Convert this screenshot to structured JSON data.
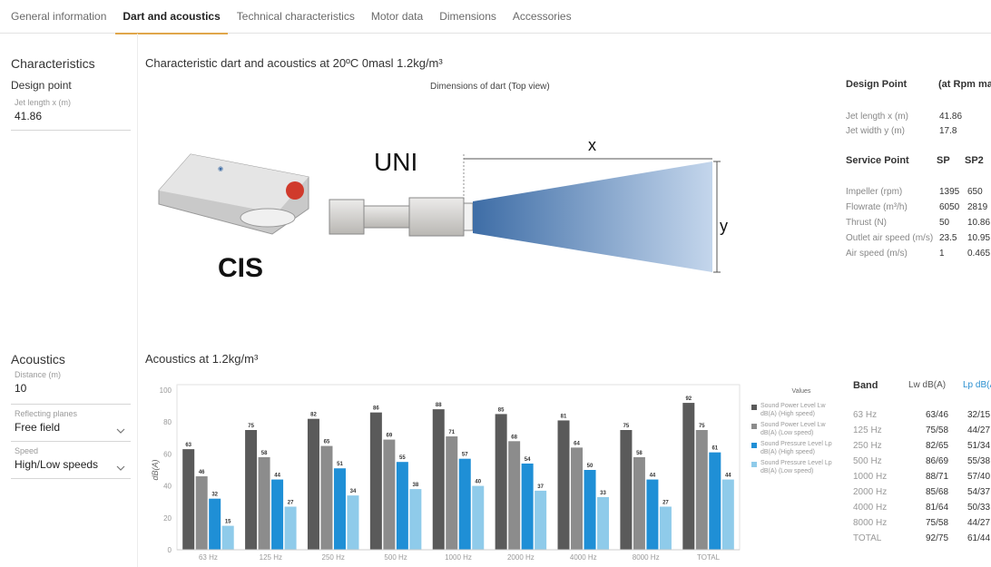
{
  "tabs": [
    {
      "label": "General information"
    },
    {
      "label": "Dart and acoustics"
    },
    {
      "label": "Technical characteristics"
    },
    {
      "label": "Motor data"
    },
    {
      "label": "Dimensions"
    },
    {
      "label": "Accessories"
    }
  ],
  "left": {
    "characteristics_title": "Characteristics",
    "design_point": "Design point",
    "jet_length_label": "Jet length x (m)",
    "jet_length_value": "41.86",
    "acoustics_title": "Acoustics",
    "distance_label": "Distance (m)",
    "distance_value": "10",
    "reflecting_label": "Reflecting planes",
    "reflecting_value": "Free field",
    "speed_label": "Speed",
    "speed_value": "High/Low speeds"
  },
  "main": {
    "dart_title": "Characteristic dart and acoustics at 20ºC 0masl 1.2kg/m³",
    "dims_title": "Dimensions of dart (Top view)",
    "acoustics_title": "Acoustics at 1.2kg/m³"
  },
  "dart": {
    "uni_label": "UNI",
    "cis_label": "CIS",
    "x_label": "x",
    "y_label": "y"
  },
  "right": {
    "design_point_head": "Design Point",
    "rpm_head": "(at Rpm max",
    "jet_length_label": "Jet length x (m)",
    "jet_length_value": "41.86",
    "jet_width_label": "Jet width y (m)",
    "jet_width_value": "17.8",
    "service_point_head": "Service Point",
    "sp_head": "SP",
    "sp2_head": "SP2",
    "rows": [
      {
        "label": "Impeller (rpm)",
        "sp": "1395",
        "sp2": "650"
      },
      {
        "label": "Flowrate (m³/h)",
        "sp": "6050",
        "sp2": "2819"
      },
      {
        "label": "Thrust (N)",
        "sp": "50",
        "sp2": "10.86"
      },
      {
        "label": "Outlet air speed (m/s)",
        "sp": "23.5",
        "sp2": "10.95"
      },
      {
        "label": "Air speed (m/s)",
        "sp": "1",
        "sp2": "0.465"
      }
    ]
  },
  "band_table": {
    "band_head": "Band",
    "lw_head": "Lw dB(A)",
    "lp_head": "Lp dB(A",
    "rows": [
      {
        "band": "63 Hz",
        "lw": "63/46",
        "lp": "32/15"
      },
      {
        "band": "125 Hz",
        "lw": "75/58",
        "lp": "44/27"
      },
      {
        "band": "250 Hz",
        "lw": "82/65",
        "lp": "51/34"
      },
      {
        "band": "500 Hz",
        "lw": "86/69",
        "lp": "55/38"
      },
      {
        "band": "1000 Hz",
        "lw": "88/71",
        "lp": "57/40"
      },
      {
        "band": "2000 Hz",
        "lw": "85/68",
        "lp": "54/37"
      },
      {
        "band": "4000 Hz",
        "lw": "81/64",
        "lp": "50/33"
      },
      {
        "band": "8000 Hz",
        "lw": "75/58",
        "lp": "44/27"
      },
      {
        "band": "TOTAL",
        "lw": "92/75",
        "lp": "61/44"
      }
    ]
  },
  "colors": {
    "accent_tab": "#e0a64a",
    "lw_high": "#5a5a5a",
    "lw_low": "#8c8c8c",
    "lp_high": "#1f8fd6",
    "lp_low": "#8fcbea",
    "lp_text": "#2a8fd0"
  },
  "chart_data": {
    "type": "bar",
    "ylabel": "dB(A)",
    "ylim": [
      0,
      100
    ],
    "yticks": [
      "0",
      "20",
      "40",
      "60",
      "80",
      "100"
    ],
    "categories": [
      "63 Hz",
      "125 Hz",
      "250 Hz",
      "500 Hz",
      "1000 Hz",
      "2000 Hz",
      "4000 Hz",
      "8000 Hz",
      "TOTAL"
    ],
    "legend_title": "Values",
    "legend_placement": "right",
    "grid": false,
    "series": [
      {
        "name": "Sound Power Level Lw dB(A) (High speed)",
        "color": "#5a5a5a",
        "values": [
          63,
          75,
          82,
          86,
          88,
          85,
          81,
          75,
          92
        ]
      },
      {
        "name": "Sound Power Level Lw dB(A) (Low speed)",
        "color": "#8c8c8c",
        "values": [
          46,
          58,
          65,
          69,
          71,
          68,
          64,
          58,
          75
        ]
      },
      {
        "name": "Sound Pressure Level Lp dB(A) (High speed)",
        "color": "#1f8fd6",
        "values": [
          32,
          44,
          51,
          55,
          57,
          54,
          50,
          44,
          61
        ]
      },
      {
        "name": "Sound Pressure Level Lp dB(A) (Low speed)",
        "color": "#8fcbea",
        "values": [
          15,
          27,
          34,
          38,
          40,
          37,
          33,
          27,
          44
        ]
      }
    ]
  }
}
